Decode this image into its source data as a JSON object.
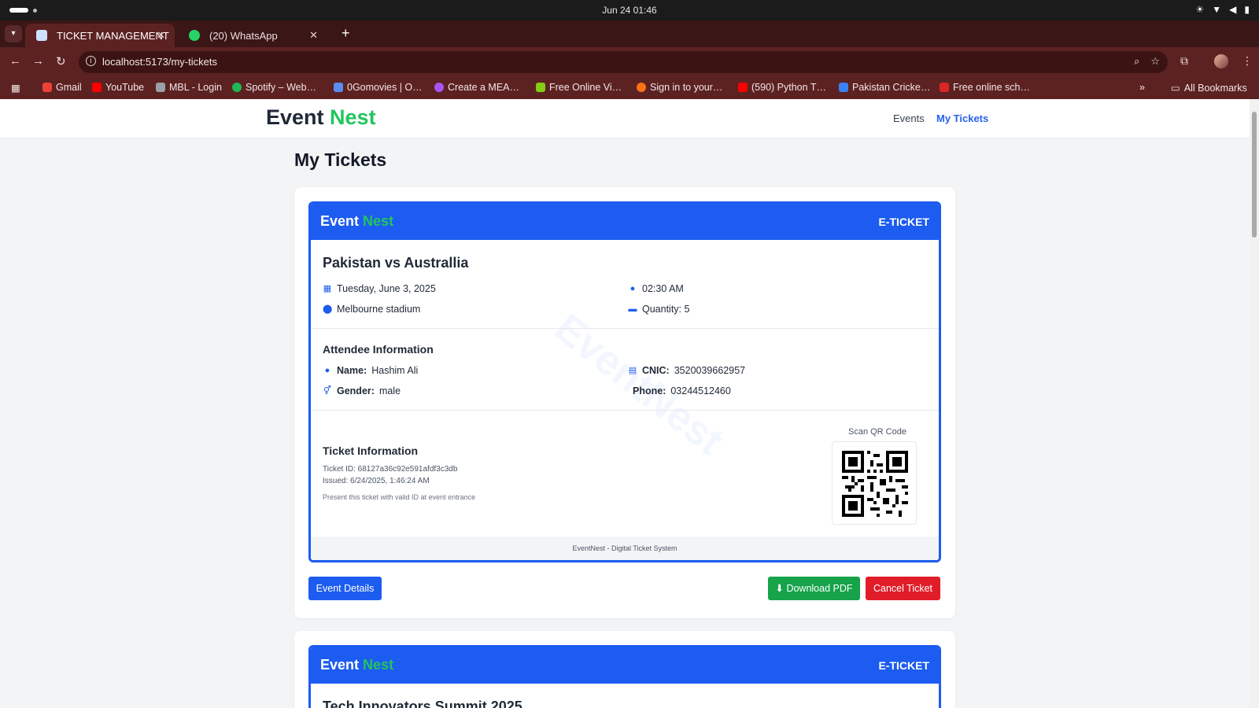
{
  "os": {
    "datetime": "Jun 24  01:46"
  },
  "browser": {
    "tabs": [
      {
        "label": "TICKET MANAGEMENT",
        "active": true
      },
      {
        "label": "(20) WhatsApp",
        "active": false
      }
    ],
    "url": "localhost:5173/my-tickets",
    "bookmarks": [
      {
        "label": "Gmail",
        "color": "#ea4335"
      },
      {
        "label": "YouTube",
        "color": "#ff0000"
      },
      {
        "label": "MBL - Login",
        "color": "#9aa0a6"
      },
      {
        "label": "Spotify – Web…",
        "color": "#1db954"
      },
      {
        "label": "0Gomovies | O…",
        "color": "#5b8def"
      },
      {
        "label": "Create a MEA…",
        "color": "#a855f7"
      },
      {
        "label": "Free Online Vi…",
        "color": "#84cc16"
      },
      {
        "label": "Sign in to your…",
        "color": "#f97316"
      },
      {
        "label": "(590) Python T…",
        "color": "#ff0000"
      },
      {
        "label": "Pakistan Cricke…",
        "color": "#3b82f6"
      },
      {
        "label": "Free online sch…",
        "color": "#dc2626"
      }
    ],
    "all_bookmarks": "All Bookmarks"
  },
  "site": {
    "logo_main": "Event",
    "logo_accent": "Nest",
    "nav": {
      "events": "Events",
      "my_tickets": "My Tickets"
    },
    "page_title": "My Tickets"
  },
  "colors": {
    "primary": "#1d5cf0",
    "accent": "#22c55e",
    "danger": "#e11d2a",
    "success": "#16a34a"
  },
  "tickets": [
    {
      "brand_main": "Event",
      "brand_accent": "Nest",
      "badge": "E-TICKET",
      "event_title": "Pakistan vs Australlia",
      "date": "Tuesday, June 3, 2025",
      "time": "02:30 AM",
      "venue": "Melbourne stadium",
      "quantity": "Quantity: 5",
      "attendee_heading": "Attendee Information",
      "name_label": "Name:",
      "name": "Hashim Ali",
      "cnic_label": "CNIC:",
      "cnic": "3520039662957",
      "gender_label": "Gender:",
      "gender": "male",
      "phone_label": "Phone:",
      "phone": "03244512460",
      "ticket_heading": "Ticket Information",
      "ticket_id": "Ticket ID: 68127a36c92e591afdf3c3db",
      "issued": "Issued: 6/24/2025, 1:46:24 AM",
      "note": "Present this ticket with valid ID at event entrance",
      "qr_label": "Scan QR Code",
      "footer": "EventNest - Digital Ticket System",
      "watermark": "EventNest",
      "buttons": {
        "details": "Event Details",
        "download": "Download PDF",
        "cancel": "Cancel Ticket"
      }
    },
    {
      "brand_main": "Event",
      "brand_accent": "Nest",
      "badge": "E-TICKET",
      "event_title": "Tech Innovators Summit 2025"
    }
  ]
}
